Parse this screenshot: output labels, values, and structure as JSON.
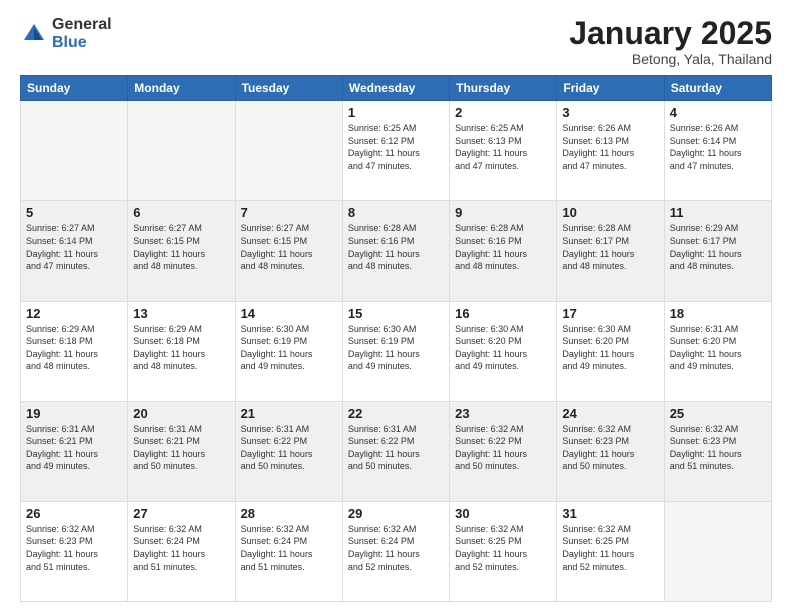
{
  "logo": {
    "general": "General",
    "blue": "Blue"
  },
  "header": {
    "title": "January 2025",
    "subtitle": "Betong, Yala, Thailand"
  },
  "weekdays": [
    "Sunday",
    "Monday",
    "Tuesday",
    "Wednesday",
    "Thursday",
    "Friday",
    "Saturday"
  ],
  "weeks": [
    [
      {
        "day": "",
        "info": ""
      },
      {
        "day": "",
        "info": ""
      },
      {
        "day": "",
        "info": ""
      },
      {
        "day": "1",
        "info": "Sunrise: 6:25 AM\nSunset: 6:12 PM\nDaylight: 11 hours\nand 47 minutes."
      },
      {
        "day": "2",
        "info": "Sunrise: 6:25 AM\nSunset: 6:13 PM\nDaylight: 11 hours\nand 47 minutes."
      },
      {
        "day": "3",
        "info": "Sunrise: 6:26 AM\nSunset: 6:13 PM\nDaylight: 11 hours\nand 47 minutes."
      },
      {
        "day": "4",
        "info": "Sunrise: 6:26 AM\nSunset: 6:14 PM\nDaylight: 11 hours\nand 47 minutes."
      }
    ],
    [
      {
        "day": "5",
        "info": "Sunrise: 6:27 AM\nSunset: 6:14 PM\nDaylight: 11 hours\nand 47 minutes."
      },
      {
        "day": "6",
        "info": "Sunrise: 6:27 AM\nSunset: 6:15 PM\nDaylight: 11 hours\nand 48 minutes."
      },
      {
        "day": "7",
        "info": "Sunrise: 6:27 AM\nSunset: 6:15 PM\nDaylight: 11 hours\nand 48 minutes."
      },
      {
        "day": "8",
        "info": "Sunrise: 6:28 AM\nSunset: 6:16 PM\nDaylight: 11 hours\nand 48 minutes."
      },
      {
        "day": "9",
        "info": "Sunrise: 6:28 AM\nSunset: 6:16 PM\nDaylight: 11 hours\nand 48 minutes."
      },
      {
        "day": "10",
        "info": "Sunrise: 6:28 AM\nSunset: 6:17 PM\nDaylight: 11 hours\nand 48 minutes."
      },
      {
        "day": "11",
        "info": "Sunrise: 6:29 AM\nSunset: 6:17 PM\nDaylight: 11 hours\nand 48 minutes."
      }
    ],
    [
      {
        "day": "12",
        "info": "Sunrise: 6:29 AM\nSunset: 6:18 PM\nDaylight: 11 hours\nand 48 minutes."
      },
      {
        "day": "13",
        "info": "Sunrise: 6:29 AM\nSunset: 6:18 PM\nDaylight: 11 hours\nand 48 minutes."
      },
      {
        "day": "14",
        "info": "Sunrise: 6:30 AM\nSunset: 6:19 PM\nDaylight: 11 hours\nand 49 minutes."
      },
      {
        "day": "15",
        "info": "Sunrise: 6:30 AM\nSunset: 6:19 PM\nDaylight: 11 hours\nand 49 minutes."
      },
      {
        "day": "16",
        "info": "Sunrise: 6:30 AM\nSunset: 6:20 PM\nDaylight: 11 hours\nand 49 minutes."
      },
      {
        "day": "17",
        "info": "Sunrise: 6:30 AM\nSunset: 6:20 PM\nDaylight: 11 hours\nand 49 minutes."
      },
      {
        "day": "18",
        "info": "Sunrise: 6:31 AM\nSunset: 6:20 PM\nDaylight: 11 hours\nand 49 minutes."
      }
    ],
    [
      {
        "day": "19",
        "info": "Sunrise: 6:31 AM\nSunset: 6:21 PM\nDaylight: 11 hours\nand 49 minutes."
      },
      {
        "day": "20",
        "info": "Sunrise: 6:31 AM\nSunset: 6:21 PM\nDaylight: 11 hours\nand 50 minutes."
      },
      {
        "day": "21",
        "info": "Sunrise: 6:31 AM\nSunset: 6:22 PM\nDaylight: 11 hours\nand 50 minutes."
      },
      {
        "day": "22",
        "info": "Sunrise: 6:31 AM\nSunset: 6:22 PM\nDaylight: 11 hours\nand 50 minutes."
      },
      {
        "day": "23",
        "info": "Sunrise: 6:32 AM\nSunset: 6:22 PM\nDaylight: 11 hours\nand 50 minutes."
      },
      {
        "day": "24",
        "info": "Sunrise: 6:32 AM\nSunset: 6:23 PM\nDaylight: 11 hours\nand 50 minutes."
      },
      {
        "day": "25",
        "info": "Sunrise: 6:32 AM\nSunset: 6:23 PM\nDaylight: 11 hours\nand 51 minutes."
      }
    ],
    [
      {
        "day": "26",
        "info": "Sunrise: 6:32 AM\nSunset: 6:23 PM\nDaylight: 11 hours\nand 51 minutes."
      },
      {
        "day": "27",
        "info": "Sunrise: 6:32 AM\nSunset: 6:24 PM\nDaylight: 11 hours\nand 51 minutes."
      },
      {
        "day": "28",
        "info": "Sunrise: 6:32 AM\nSunset: 6:24 PM\nDaylight: 11 hours\nand 51 minutes."
      },
      {
        "day": "29",
        "info": "Sunrise: 6:32 AM\nSunset: 6:24 PM\nDaylight: 11 hours\nand 52 minutes."
      },
      {
        "day": "30",
        "info": "Sunrise: 6:32 AM\nSunset: 6:25 PM\nDaylight: 11 hours\nand 52 minutes."
      },
      {
        "day": "31",
        "info": "Sunrise: 6:32 AM\nSunset: 6:25 PM\nDaylight: 11 hours\nand 52 minutes."
      },
      {
        "day": "",
        "info": ""
      }
    ]
  ]
}
